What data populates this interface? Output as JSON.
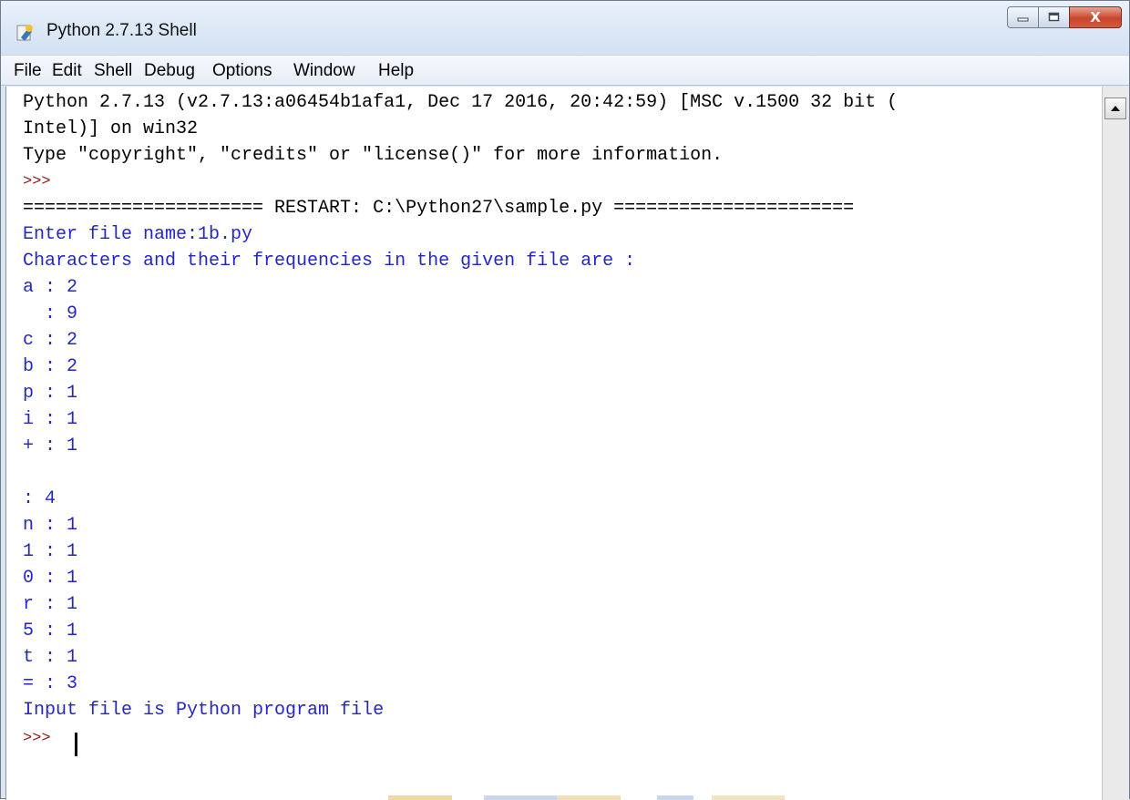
{
  "window": {
    "title": "Python 2.7.13 Shell",
    "icon": "python-idle-icon",
    "controls": {
      "minimize": "minimize-icon",
      "maximize": "maximize-icon",
      "close_label": "X"
    }
  },
  "menu": {
    "file": "File",
    "edit": "Edit",
    "shell": "Shell",
    "debug": "Debug",
    "options": "Options",
    "window": "Window",
    "help": "Help"
  },
  "shell": {
    "banner1": "Python 2.7.13 (v2.7.13:a06454b1afa1, Dec 17 2016, 20:42:59) [MSC v.1500 32 bit (",
    "banner2": "Intel)] on win32",
    "banner3": "Type \"copyright\", \"credits\" or \"license()\" for more information.",
    "prompt1": ">>> ",
    "restart": "====================== RESTART: C:\\Python27\\sample.py ======================",
    "output": [
      "Enter file name:1b.py",
      "Characters and their frequencies in the given file are :",
      "a : 2",
      "  : 9",
      "c : 2",
      "b : 2",
      "p : 1",
      "i : 1",
      "+ : 1",
      "",
      ": 4",
      "n : 1",
      "1 : 1",
      "0 : 1",
      "r : 1",
      "5 : 1",
      "t : 1",
      "= : 3",
      "Input file is Python program file"
    ],
    "prompt2": ">>> "
  },
  "colors": {
    "stdout": "#2426c8",
    "prompt": "#8a1b12",
    "text": "#000000",
    "titlebar": "#dbe6f3"
  }
}
